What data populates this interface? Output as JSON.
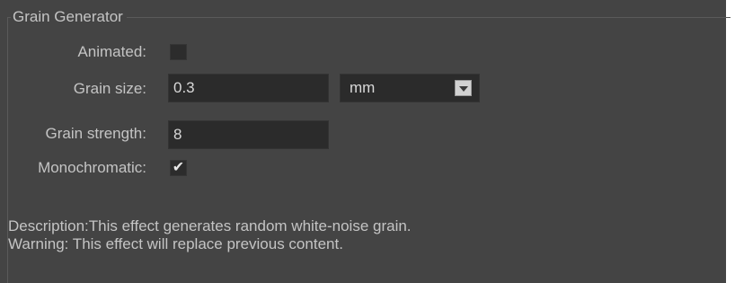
{
  "group": {
    "title": "Grain Generator"
  },
  "fields": {
    "animated": {
      "label": "Animated:",
      "checked": false
    },
    "grain_size": {
      "label": "Grain size:",
      "value": "0.3",
      "unit": "mm"
    },
    "grain_strength": {
      "label": "Grain strength:",
      "value": "8"
    },
    "monochromatic": {
      "label": "Monochromatic:",
      "checked": true,
      "check_glyph": "✔"
    }
  },
  "info": {
    "description": "Description:This effect generates random white-noise grain.",
    "warning": "Warning: This effect will replace previous content."
  },
  "colors": {
    "panel_bg": "#444444",
    "field_bg": "#2b2b2b",
    "text": "#c4c4c4"
  }
}
